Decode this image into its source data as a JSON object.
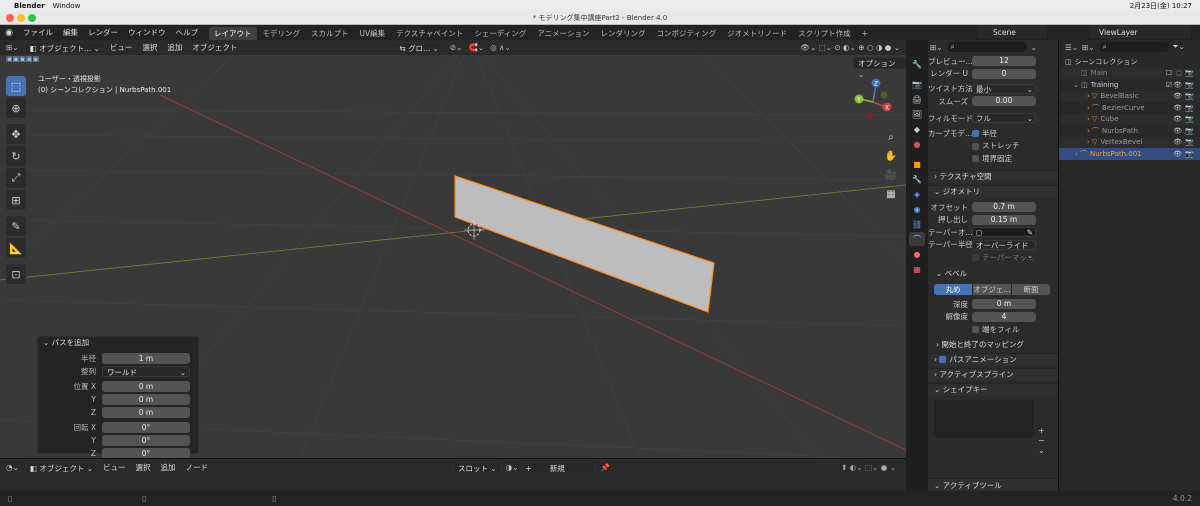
{
  "macos": {
    "app": "Blender",
    "window_menu": "Window",
    "status_datetime": "2月23日(金)  10:27"
  },
  "window": {
    "title": "* モデリング集中講座Part2 - Blender 4.0"
  },
  "topbar": {
    "menus": [
      "ファイル",
      "編集",
      "レンダー",
      "ウィンドウ",
      "ヘルプ"
    ],
    "workspaces": [
      "レイアウト",
      "モデリング",
      "スカルプト",
      "UV編集",
      "テクスチャペイント",
      "シェーディング",
      "アニメーション",
      "レンダリング",
      "コンポジティング",
      "ジオメトリノード",
      "スクリプト作成"
    ],
    "active_workspace": "レイアウト",
    "add_tab": "+",
    "scene": "Scene",
    "view_layer": "ViewLayer"
  },
  "viewport": {
    "mode": "オブジェクト...",
    "menus": [
      "ビュー",
      "選択",
      "追加",
      "オブジェクト"
    ],
    "transform_orientation": "グロ...",
    "options": "オプション",
    "overlay_line1": "ユーザー・透視投影",
    "overlay_line2": "(0) シーンコレクション | NurbsPath.001",
    "gizmo": {
      "x": "X",
      "y": "Y",
      "z": "Z"
    }
  },
  "operator_panel": {
    "title": "パスを追加",
    "rows": [
      {
        "label": "半径",
        "value": "1 m"
      },
      {
        "label": "整列",
        "value": "ワールド",
        "dropdown": true
      },
      {
        "label": "位置 X",
        "value": "0 m"
      },
      {
        "label": "Y",
        "value": "0 m"
      },
      {
        "label": "Z",
        "value": "0 m"
      },
      {
        "label": "回転 X",
        "value": "0°"
      },
      {
        "label": "Y",
        "value": "0°"
      },
      {
        "label": "Z",
        "value": "0°"
      }
    ]
  },
  "timeline": {
    "mode": "オブジェクト",
    "menus": [
      "ビュー",
      "選択",
      "追加",
      "ノード"
    ],
    "slot": "スロット",
    "new": "新規",
    "plus": "+"
  },
  "properties": {
    "rows": [
      {
        "label": "プレビュー...",
        "value": "12"
      },
      {
        "label": "レンダー U",
        "value": "0"
      }
    ],
    "twist_method_label": "ツイスト方法",
    "twist_method": "最小",
    "smooth_label": "スムーズ",
    "smooth": "0.00",
    "fill_mode_label": "フィルモード",
    "fill_mode": "フル",
    "curve_deform_label": "カーブモデ...",
    "radius_label": "半径",
    "stretch_label": "ストレッチ",
    "bounds_label": "境界固定",
    "texture_space": "テクスチャ空間",
    "geometry": "ジオメトリ",
    "offset_label": "オフセット",
    "offset": "0.7 m",
    "extrude_label": "押し出し",
    "extrude": "0.15 m",
    "taper_obj_label": "テーパーオ...",
    "taper_radius_label": "テーパー半径",
    "taper_radius": "オーバーライド",
    "taper_map": "テーパーマッ...",
    "bevel": "ベベル",
    "bevel_tabs": [
      "丸め",
      "オブジェ...",
      "断面"
    ],
    "depth_label": "深度",
    "depth": "0 m",
    "resolution_label": "解像度",
    "resolution": "4",
    "fill_caps": "端をフィル",
    "start_end_mapping": "開始と終了のマッピング",
    "path_animation": "パスアニメーション",
    "active_spline": "アクティブスプライン",
    "shape_keys": "シェイプキー",
    "active_tool": "アクティブツール"
  },
  "outliner": {
    "title": "シーンコレクション",
    "items": [
      {
        "name": "Main",
        "indent": 1
      },
      {
        "name": "Training",
        "indent": 1
      },
      {
        "name": "BevelBasic",
        "indent": 2
      },
      {
        "name": "BezierCurve",
        "indent": 2
      },
      {
        "name": "Cube",
        "indent": 2
      },
      {
        "name": "NurbsPath",
        "indent": 2
      },
      {
        "name": "VertexBevel",
        "indent": 2
      },
      {
        "name": "NurbsPath.001",
        "indent": 1,
        "selected": true
      }
    ]
  },
  "statusbar": {
    "version": "4.0.2"
  },
  "colors": {
    "accent": "#4772b3",
    "selection": "#ff8c1a",
    "x_axis": "#c04545",
    "y_axis": "#8bbd3a"
  }
}
